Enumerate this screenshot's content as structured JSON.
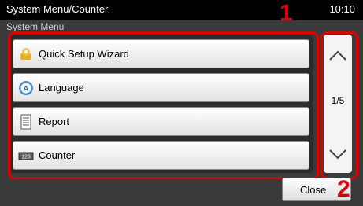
{
  "titlebar": {
    "title": "System Menu/Counter.",
    "time": "10:10"
  },
  "subtitle": "System Menu",
  "callouts": {
    "one": "1",
    "two": "2"
  },
  "menu": [
    {
      "label": "Quick Setup Wizard",
      "icon": "wizard-icon"
    },
    {
      "label": "Language",
      "icon": "language-icon"
    },
    {
      "label": "Report",
      "icon": "report-icon"
    },
    {
      "label": "Counter",
      "icon": "counter-icon"
    }
  ],
  "scroll": {
    "page": "1/5"
  },
  "close_label": "Close",
  "colors": {
    "callout": "#e00000",
    "titlebar": "#000000",
    "background": "#3a3a3a"
  }
}
